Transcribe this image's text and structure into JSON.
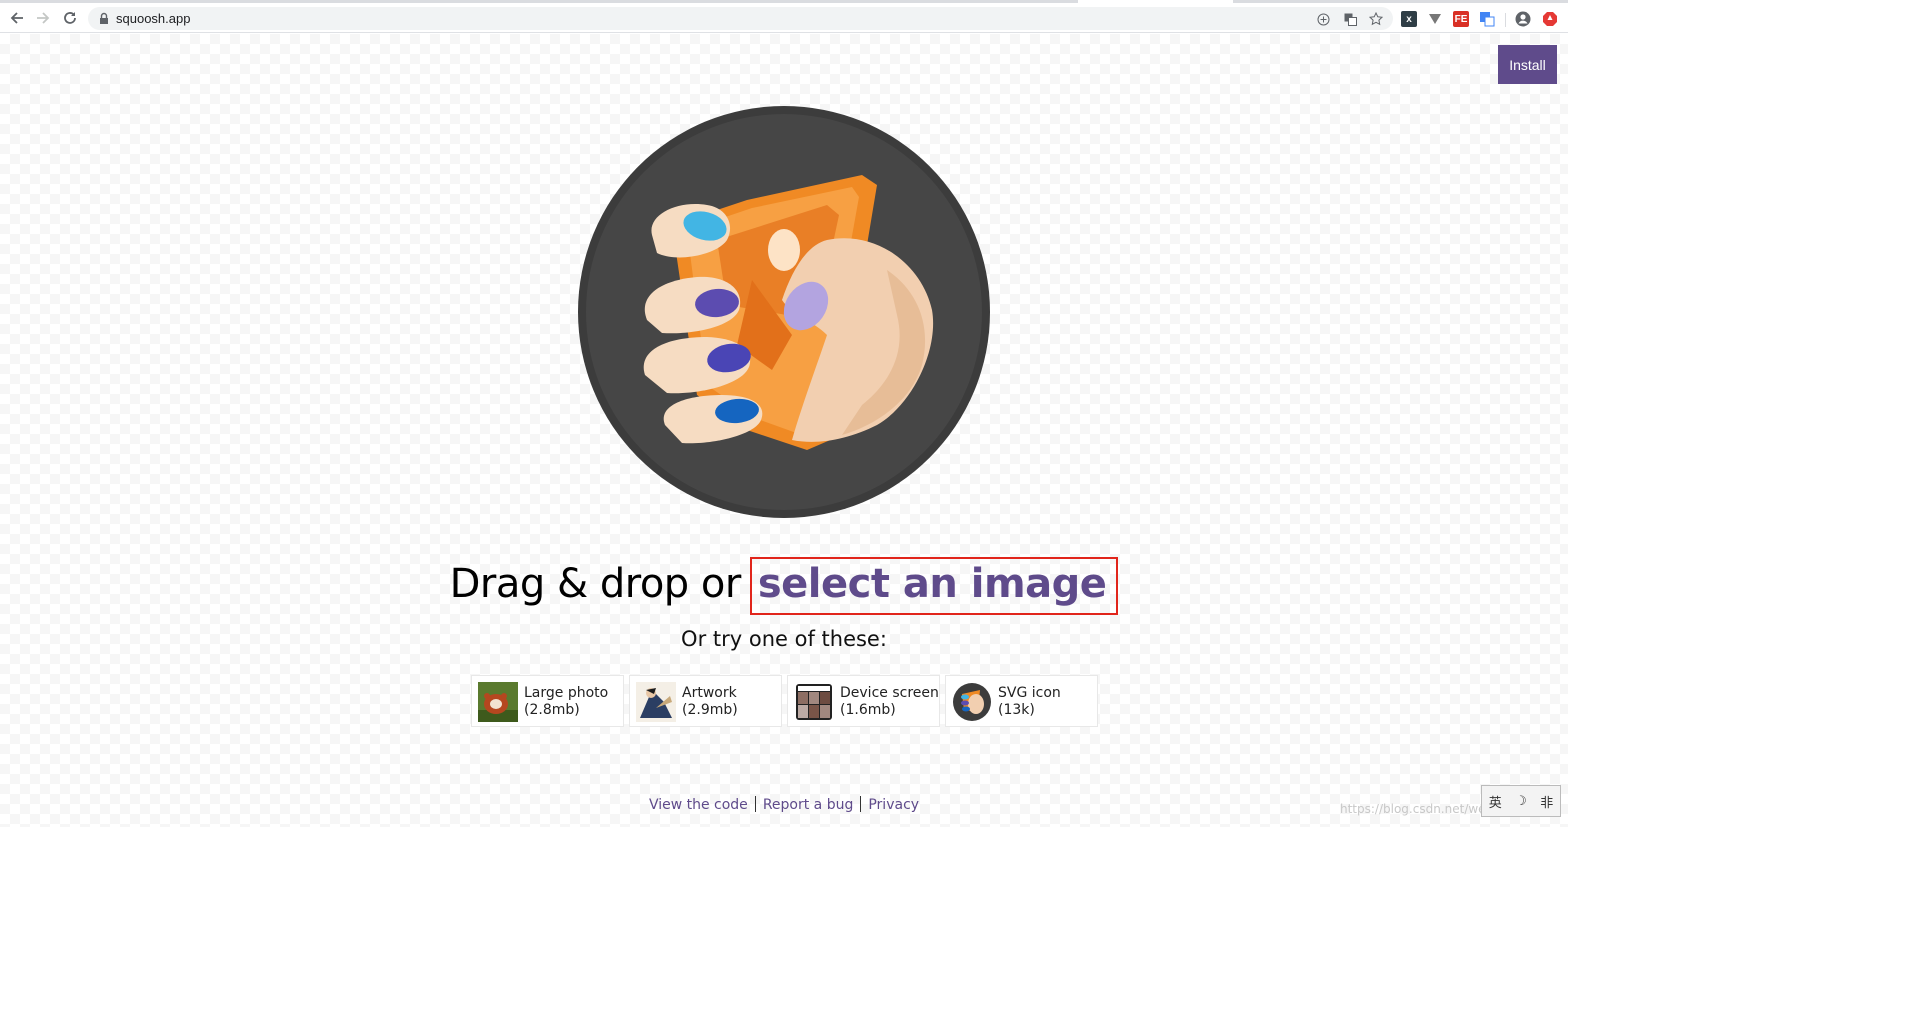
{
  "browser": {
    "url": "squoosh.app"
  },
  "header": {
    "install_label": "Install"
  },
  "main": {
    "headline_lead": "Drag & drop or",
    "select_label": "select an image",
    "try_label": "Or try one of these:",
    "demos": [
      {
        "name": "Large photo",
        "size": "(2.8mb)"
      },
      {
        "name": "Artwork",
        "size": "(2.9mb)"
      },
      {
        "name": "Device screen",
        "size": "(1.6mb)"
      },
      {
        "name": "SVG icon",
        "size": "(13k)"
      }
    ]
  },
  "footer": {
    "links": [
      "View the code",
      "Report a bug",
      "Privacy"
    ]
  },
  "overlay": {
    "watermark": "https://blog.csdn.net/weixin_",
    "ime": [
      "英",
      "☽",
      "非"
    ]
  },
  "colors": {
    "accent": "#5f4b8b",
    "highlight_border": "#e1251b",
    "logo_background": "#3c3c3c",
    "note_orange": "#f08a24"
  }
}
